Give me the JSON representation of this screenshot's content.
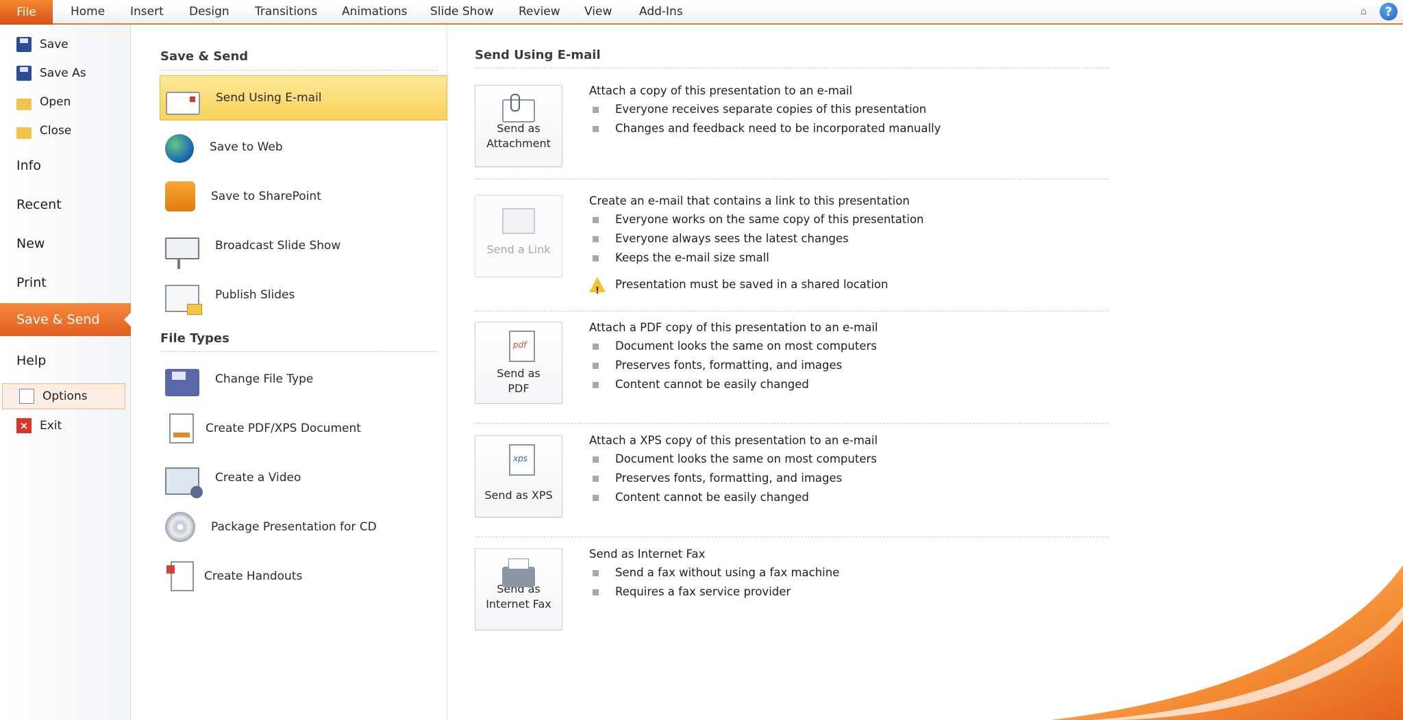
{
  "ribbon": {
    "file_tab": "File",
    "tabs": [
      "Home",
      "Insert",
      "Design",
      "Transitions",
      "Animations",
      "Slide Show",
      "Review",
      "View",
      "Add-Ins"
    ]
  },
  "nav": {
    "commands": [
      "Save",
      "Save As",
      "Open",
      "Close"
    ],
    "pages": [
      "Info",
      "Recent",
      "New",
      "Print",
      "Save & Send",
      "Help"
    ],
    "options": "Options",
    "exit": "Exit",
    "selected": "Save & Send"
  },
  "save_send": {
    "heading": "Save & Send",
    "items": [
      "Send Using E-mail",
      "Save to Web",
      "Save to SharePoint",
      "Broadcast Slide Show",
      "Publish Slides"
    ],
    "selected": "Send Using E-mail"
  },
  "file_types": {
    "heading": "File Types",
    "items": [
      "Change File Type",
      "Create PDF/XPS Document",
      "Create a Video",
      "Package Presentation for CD",
      "Create Handouts"
    ]
  },
  "email_panel": {
    "title": "Send Using E-mail",
    "options": [
      {
        "button_line1": "Send as",
        "button_line2": "Attachment",
        "enabled": true,
        "heading": "Attach a copy of this presentation to an e-mail",
        "bullets": [
          "Everyone receives separate copies of this presentation",
          "Changes and feedback need to be incorporated manually"
        ]
      },
      {
        "button_line1": "Send a Link",
        "button_line2": "",
        "enabled": false,
        "heading": "Create an e-mail that contains a link to this presentation",
        "bullets": [
          "Everyone works on the same copy of this presentation",
          "Everyone always sees the latest changes",
          "Keeps the e-mail size small"
        ],
        "warning": "Presentation must be saved in a shared location"
      },
      {
        "button_line1": "Send as",
        "button_line2": "PDF",
        "enabled": true,
        "heading": "Attach a PDF copy of this presentation to an e-mail",
        "bullets": [
          "Document looks the same on most computers",
          "Preserves fonts, formatting, and images",
          "Content cannot be easily changed"
        ]
      },
      {
        "button_line1": "Send as XPS",
        "button_line2": "",
        "enabled": true,
        "heading": "Attach a XPS copy of this presentation to an e-mail",
        "bullets": [
          "Document looks the same on most computers",
          "Preserves fonts, formatting, and images",
          "Content cannot be easily changed"
        ]
      },
      {
        "button_line1": "Send as",
        "button_line2": "Internet Fax",
        "enabled": true,
        "heading": "Send as Internet Fax",
        "bullets": [
          "Send a fax without using a fax machine",
          "Requires a fax service provider"
        ]
      }
    ]
  },
  "colors": {
    "accent_orange": "#e35d1e",
    "selection_yellow": "#f9d257"
  },
  "icons": {
    "help": "help-icon",
    "collapse": "collapse-ribbon-icon"
  }
}
